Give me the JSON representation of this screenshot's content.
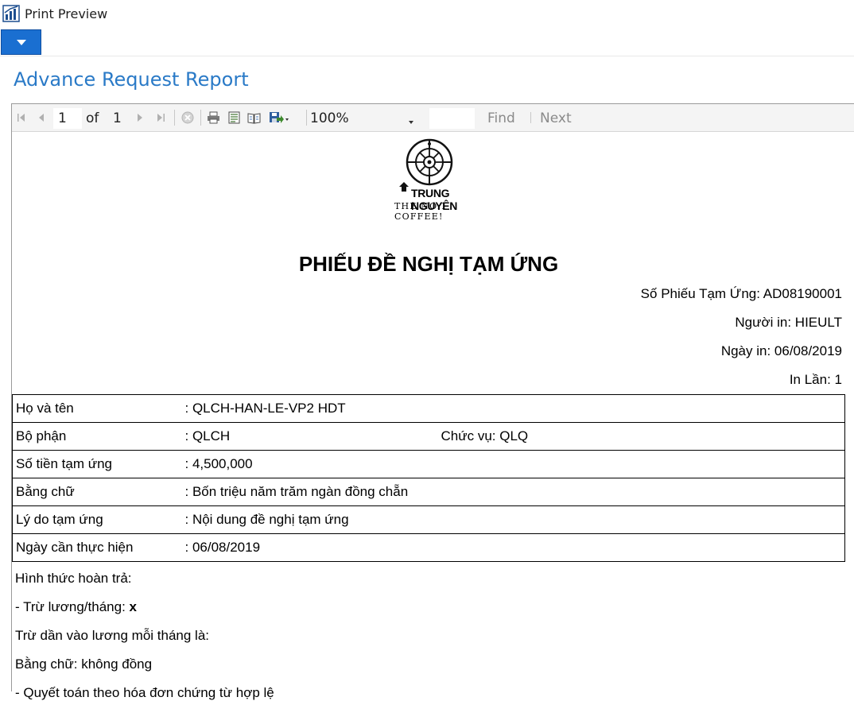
{
  "window": {
    "title": "Print Preview"
  },
  "page": {
    "heading": "Advance Request Report"
  },
  "toolbar": {
    "page_current": "1",
    "of_label": "of",
    "page_total": "1",
    "zoom": "100%",
    "find_value": "",
    "find_label": "Find",
    "next_label": "Next"
  },
  "report": {
    "logo": {
      "brand": "TRUNG NGUYÊN",
      "slogan": "THE NO.1 COFFEE!"
    },
    "title": "PHIẾU ĐỀ NGHỊ TẠM ỨNG",
    "meta": {
      "voucher": "Số Phiếu Tạm Ứng: AD08190001",
      "printed_by": "Người in: HIEULT",
      "print_date": "Ngày in: 06/08/2019",
      "print_count": "In Lần: 1"
    },
    "rows": [
      {
        "label": "Họ và tên",
        "value": ": QLCH-HAN-LE-VP2 HDT",
        "extra": ""
      },
      {
        "label": "Bộ phận",
        "value": ": QLCH",
        "extra": "Chức vụ: QLQ"
      },
      {
        "label": "Số tiền tạm ứng",
        "value": ": 4,500,000",
        "extra": ""
      },
      {
        "label": "Bằng chữ",
        "value": ": Bốn triệu năm trăm ngàn đồng chẵn",
        "extra": ""
      },
      {
        "label": "Lý do tạm ứng",
        "value": ": Nội dung đề nghị tạm ứng",
        "extra": ""
      },
      {
        "label": "Ngày cần thực hiện",
        "value": ": 06/08/2019",
        "extra": ""
      }
    ],
    "repayment": {
      "heading": "Hình thức hoàn trả:",
      "salary_deduct_label": "- Trừ lương/tháng: ",
      "salary_deduct_mark": "x",
      "monthly_deduct": "Trừ dần vào lương mỗi tháng là:",
      "in_words": "Bằng chữ: không đồng",
      "settlement": "- Quyết toán theo hóa đơn chứng từ hợp lệ"
    }
  }
}
